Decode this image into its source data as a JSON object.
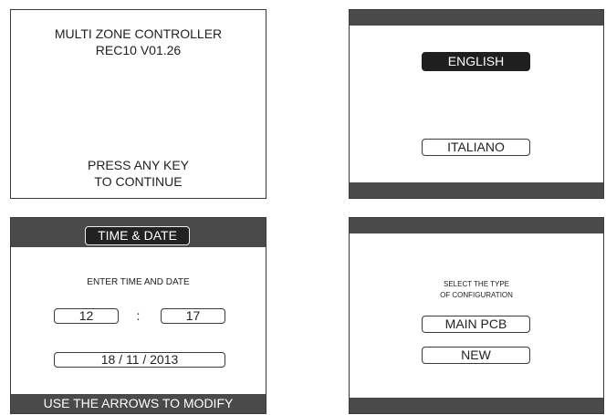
{
  "screen1": {
    "title_line1": "MULTI ZONE CONTROLLER",
    "title_line2": "REC10 V01.26",
    "prompt_line1": "PRESS ANY KEY",
    "prompt_line2": "TO CONTINUE"
  },
  "screen2": {
    "languages": [
      "ENGLISH",
      "ITALIANO"
    ],
    "selected": "ENGLISH"
  },
  "screen3": {
    "title": "TIME & DATE",
    "instruction": "ENTER TIME AND DATE",
    "hour": "12",
    "separator": ":",
    "minute": "17",
    "date": "18 / 11 / 2013",
    "footer": "USE THE ARROWS TO MODIFY"
  },
  "screen4": {
    "instruction_line1": "SELECT THE TYPE",
    "instruction_line2": "OF CONFIGURATION",
    "options": [
      "MAIN PCB",
      "NEW"
    ]
  }
}
